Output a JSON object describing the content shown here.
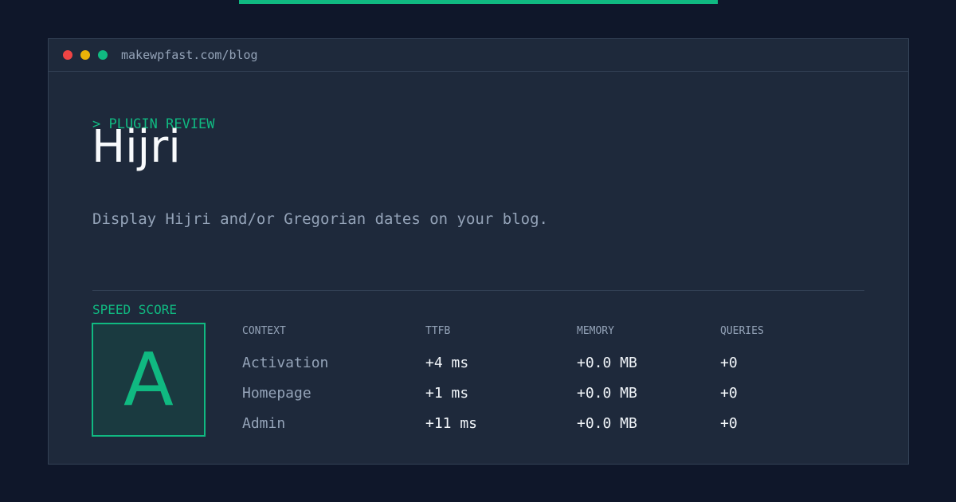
{
  "window": {
    "url": "makewpfast.com/blog",
    "controls": [
      "close",
      "minimize",
      "maximize"
    ]
  },
  "colors": {
    "accent": "#10b981",
    "background": "#0f172a",
    "panel": "#1e293b",
    "muted_text": "#94a3b8",
    "heading_text": "#f8fafc",
    "dot_red": "#ef4444",
    "dot_yellow": "#eab308",
    "dot_green": "#10b981"
  },
  "header": {
    "eyebrow": "> PLUGIN REVIEW",
    "title": "Hijri",
    "description": "Display Hijri and/or Gregorian dates on your blog."
  },
  "speed_score": {
    "label": "SPEED SCORE",
    "grade": "A"
  },
  "metrics_table": {
    "headers": [
      "CONTEXT",
      "TTFB",
      "MEMORY",
      "QUERIES"
    ],
    "rows": [
      {
        "context": "Activation",
        "ttfb": "+4 ms",
        "memory": "+0.0 MB",
        "queries": "+0"
      },
      {
        "context": "Homepage",
        "ttfb": "+1 ms",
        "memory": "+0.0 MB",
        "queries": "+0"
      },
      {
        "context": "Admin",
        "ttfb": "+11 ms",
        "memory": "+0.0 MB",
        "queries": "+0"
      }
    ]
  }
}
